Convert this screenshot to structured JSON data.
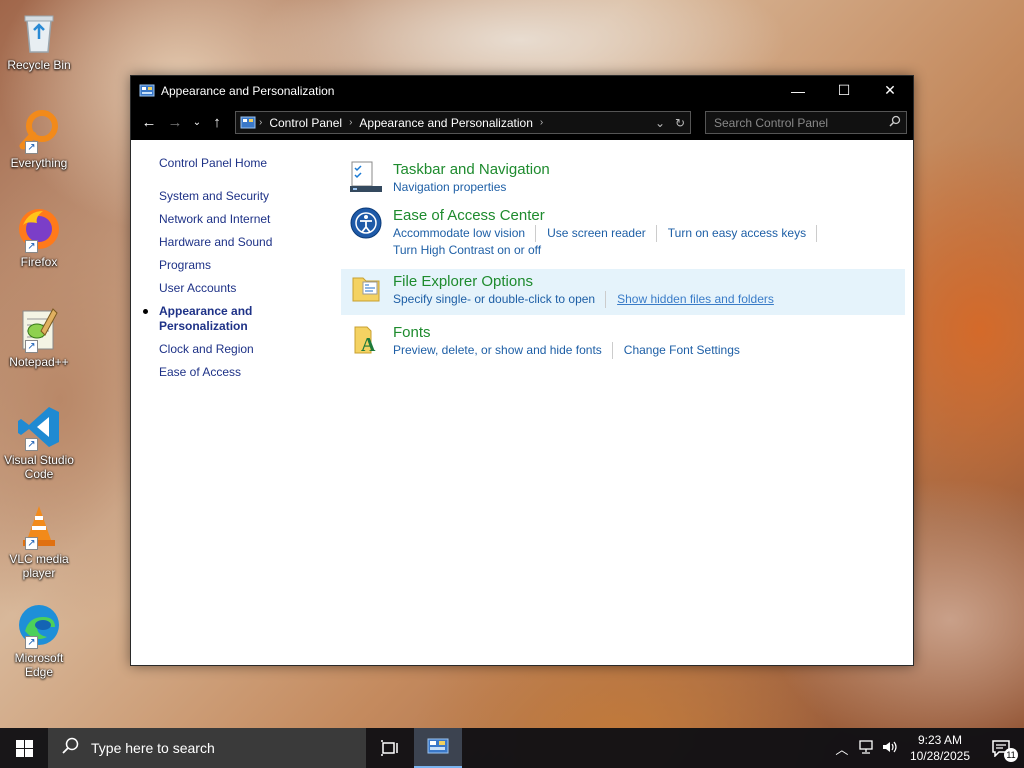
{
  "desktop": {
    "icons": [
      {
        "label": "Recycle Bin",
        "icon": "recycle-bin-icon"
      },
      {
        "label": "Everything",
        "icon": "magnifier-icon"
      },
      {
        "label": "Firefox",
        "icon": "firefox-icon"
      },
      {
        "label": "Notepad++",
        "icon": "notepadpp-icon"
      },
      {
        "label": "Visual Studio Code",
        "icon": "vscode-icon"
      },
      {
        "label": "VLC media player",
        "icon": "vlc-cone-icon"
      },
      {
        "label": "Microsoft Edge",
        "icon": "edge-icon"
      }
    ]
  },
  "window": {
    "title": "Appearance and Personalization",
    "controls": {
      "minimize": "—",
      "maximize": "☐",
      "close": "✕"
    },
    "nav": {
      "back": "←",
      "forward": "→",
      "recent": "⌄",
      "up": "↑"
    },
    "breadcrumb": [
      "Control Panel",
      "Appearance and Personalization"
    ],
    "search_placeholder": "Search Control Panel"
  },
  "sidebar": {
    "home": "Control Panel Home",
    "items": [
      {
        "label": "System and Security",
        "active": false
      },
      {
        "label": "Network and Internet",
        "active": false
      },
      {
        "label": "Hardware and Sound",
        "active": false
      },
      {
        "label": "Programs",
        "active": false
      },
      {
        "label": "User Accounts",
        "active": false
      },
      {
        "label": "Appearance and Personalization",
        "active": true
      },
      {
        "label": "Clock and Region",
        "active": false
      },
      {
        "label": "Ease of Access",
        "active": false
      }
    ]
  },
  "tasks": [
    {
      "title": "Taskbar and Navigation",
      "icon": "taskbar-icon",
      "links": [
        "Navigation properties"
      ]
    },
    {
      "title": "Ease of Access Center",
      "icon": "ease-of-access-icon",
      "links": [
        "Accommodate low vision",
        "Use screen reader",
        "Turn on easy access keys",
        "Turn High Contrast on or off"
      ]
    },
    {
      "title": "File Explorer Options",
      "icon": "folder-options-icon",
      "links": [
        "Specify single- or double-click to open",
        "Show hidden files and folders"
      ]
    },
    {
      "title": "Fonts",
      "icon": "fonts-icon",
      "links": [
        "Preview, delete, or show and hide fonts",
        "Change Font Settings"
      ]
    }
  ],
  "taskbar": {
    "search_placeholder": "Type here to search",
    "time": "9:23 AM",
    "date": "10/28/2025",
    "notification_count": "11"
  },
  "colors": {
    "task_title": "#1e8b2e",
    "link": "#1e5fa6",
    "sidebar_link": "#1e3287",
    "hover_bg": "#e5f3fb"
  }
}
